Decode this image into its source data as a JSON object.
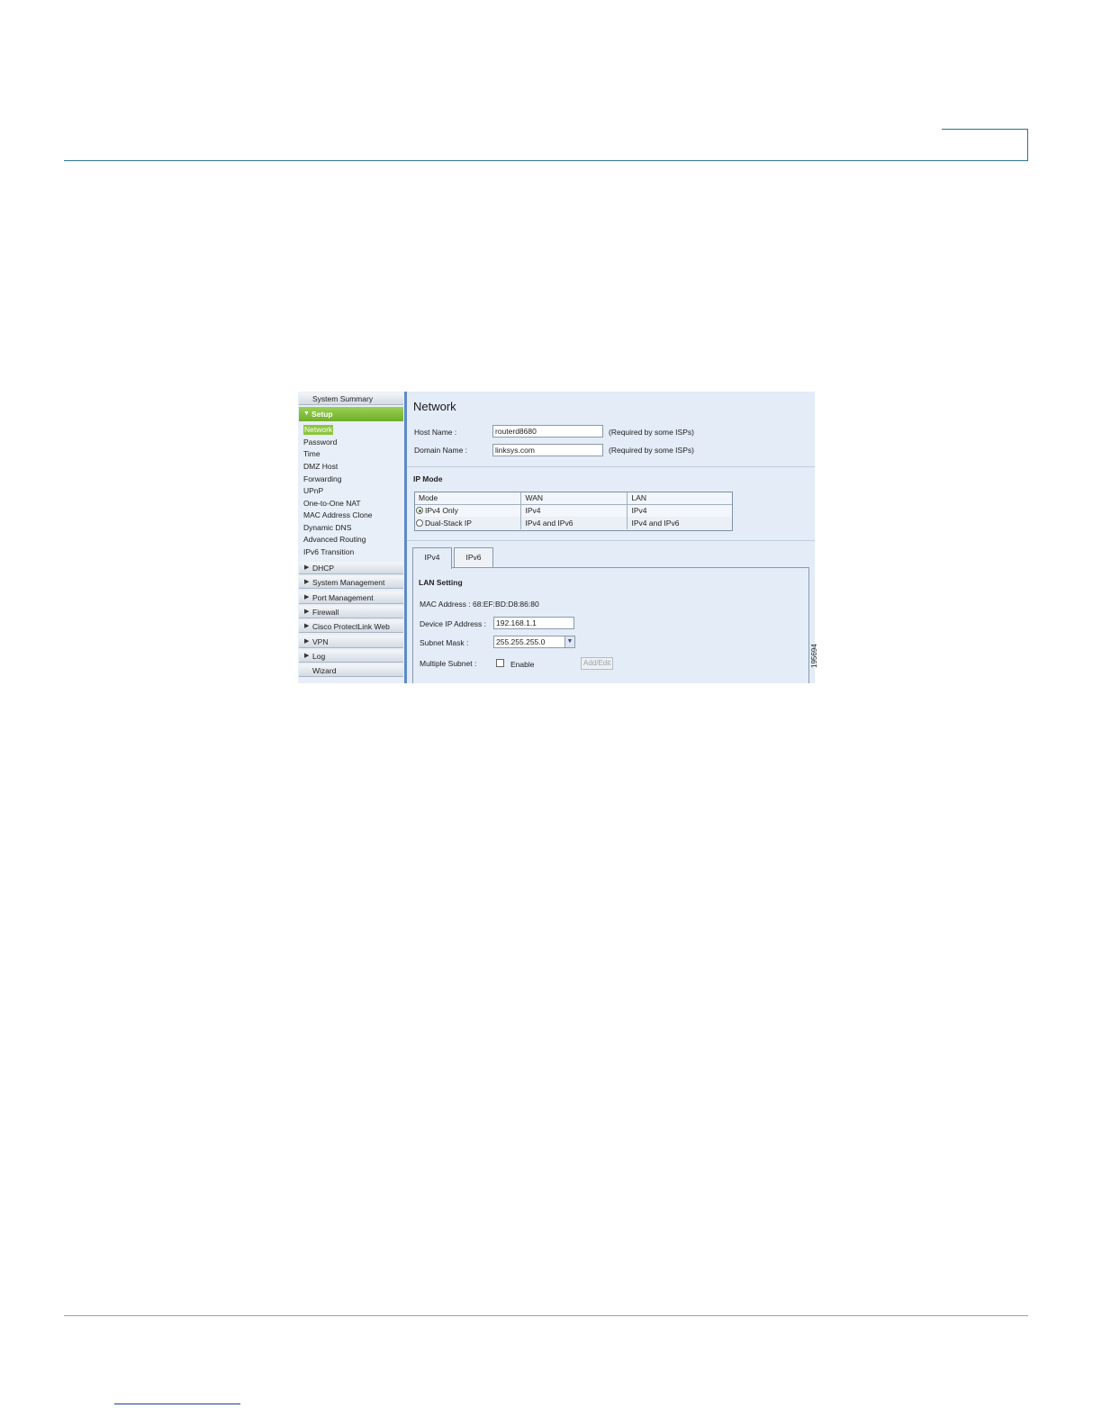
{
  "figure_id": "195694",
  "sidebar": {
    "system_summary": "System Summary",
    "setup": "Setup",
    "setup_items": [
      "Network",
      "Password",
      "Time",
      "DMZ Host",
      "Forwarding",
      "UPnP",
      "One-to-One NAT",
      "MAC Address Clone",
      "Dynamic DNS",
      "Advanced Routing",
      "IPv6 Transition"
    ],
    "sections": [
      "DHCP",
      "System Management",
      "Port Management",
      "Firewall",
      "Cisco ProtectLink Web",
      "VPN",
      "Log"
    ],
    "wizard": "Wizard"
  },
  "main": {
    "title": "Network",
    "host_name_label": "Host Name :",
    "host_name_value": "routerd8680",
    "domain_name_label": "Domain Name :",
    "domain_name_value": "linksys.com",
    "required_note": "(Required by some ISPs)",
    "ip_mode": {
      "heading": "IP Mode",
      "columns": [
        "Mode",
        "WAN",
        "LAN"
      ],
      "rows": [
        {
          "mode": "IPv4 Only",
          "wan": "IPv4",
          "lan": "IPv4",
          "selected": true
        },
        {
          "mode": "Dual-Stack IP",
          "wan": "IPv4 and IPv6",
          "lan": "IPv4 and IPv6",
          "selected": false
        }
      ]
    },
    "tabs": [
      "IPv4",
      "IPv6"
    ],
    "lan": {
      "heading": "LAN Setting",
      "mac_label": "MAC Address :",
      "mac_value": "68:EF:BD:D8:86:80",
      "device_ip_label": "Device IP Address :",
      "device_ip_value": "192.168.1.1",
      "subnet_mask_label": "Subnet Mask :",
      "subnet_mask_value": "255.255.255.0",
      "multiple_subnet_label": "Multiple Subnet :",
      "enable_label": "Enable",
      "add_edit_label": "Add/Edit"
    }
  }
}
